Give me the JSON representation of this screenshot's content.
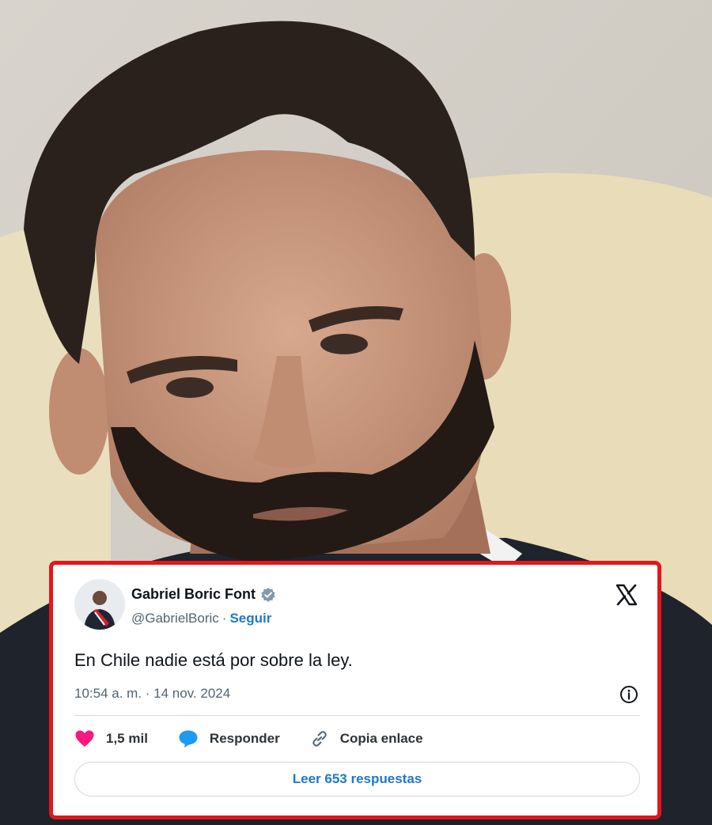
{
  "tweet": {
    "author_name": "Gabriel Boric Font",
    "handle": "@GabrielBoric",
    "separator": "·",
    "follow_label": "Seguir",
    "text": "En Chile nadie está por sobre la ley.",
    "timestamp": "10:54 a. m. · 14 nov. 2024",
    "likes_count": "1,5 mil",
    "reply_label": "Responder",
    "copy_link_label": "Copia enlace",
    "read_replies_label": "Leer 653 respuestas"
  },
  "colors": {
    "card_border": "#e3161c",
    "link_blue": "#1d77d2",
    "heart": "#f91880",
    "reply_bubble": "#1d9bf0",
    "verified_badge": "#829aab"
  },
  "icons": [
    "verified-badge-icon",
    "x-logo-icon",
    "info-icon",
    "heart-icon",
    "reply-icon",
    "link-icon"
  ]
}
